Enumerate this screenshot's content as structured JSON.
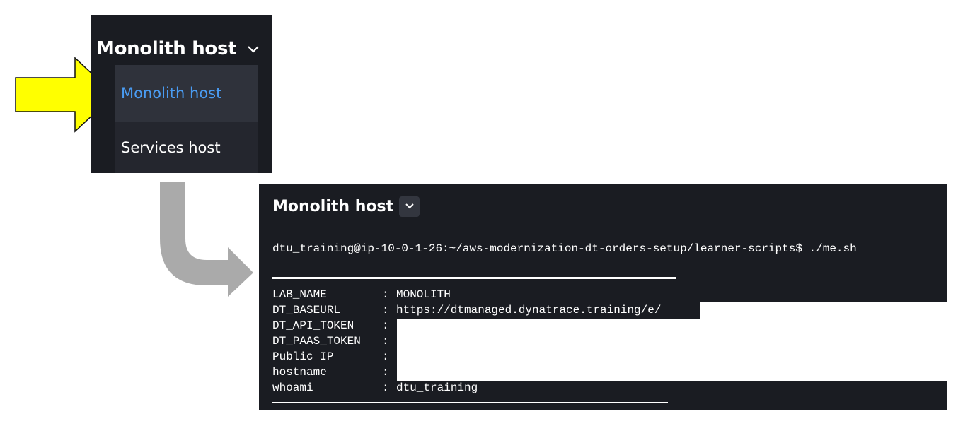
{
  "menu": {
    "title": "Monolith host",
    "items": [
      {
        "label": "Monolith host",
        "selected": true
      },
      {
        "label": "Services host",
        "selected": false
      }
    ],
    "selected_color": "#4a9cf3"
  },
  "terminal": {
    "title": "Monolith host",
    "prompt": "dtu_training@ip-10-0-1-26:~/aws-modernization-dt-orders-setup/learner-scripts$ ./me.sh",
    "rows": [
      {
        "key": "LAB_NAME",
        "value": "MONOLITH"
      },
      {
        "key": "DT_BASEURL",
        "value": "https://dtmanaged.dynatrace.training/e/"
      },
      {
        "key": "DT_API_TOKEN",
        "value": ""
      },
      {
        "key": "DT_PAAS_TOKEN",
        "value": ""
      },
      {
        "key": "Public IP",
        "value": ""
      },
      {
        "key": "hostname",
        "value": ""
      },
      {
        "key": "whoami",
        "value": "dtu_training"
      }
    ]
  },
  "colors": {
    "yellow_arrow": "#ffff00",
    "gray_arrow": "#aaaaaa",
    "panel_bg": "#1a1c22"
  }
}
